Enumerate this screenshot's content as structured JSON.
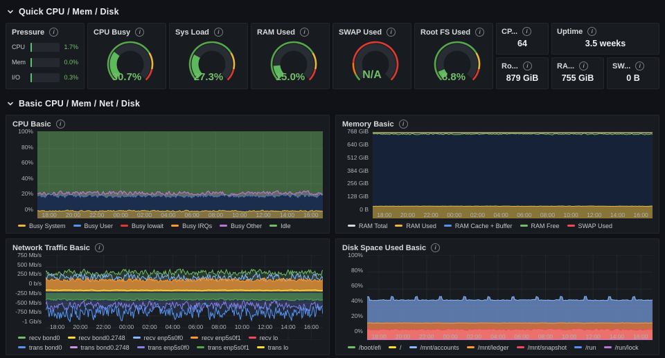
{
  "sections": {
    "quick": {
      "title": "Quick CPU / Mem / Disk"
    },
    "basic": {
      "title": "Basic CPU / Mem / Net / Disk"
    }
  },
  "pressure": {
    "title": "Pressure",
    "rows": [
      {
        "label": "CPU",
        "value": "1.7%",
        "frac": 0.017
      },
      {
        "label": "Mem",
        "value": "0.0%",
        "frac": 0.0
      },
      {
        "label": "I/O",
        "value": "0.3%",
        "frac": 0.003
      }
    ]
  },
  "gauge_segments": {
    "normal": [
      {
        "f0": 0,
        "f1": 0.72,
        "color": "#56A64B"
      },
      {
        "f0": 0.72,
        "f1": 0.88,
        "color": "#EAB839"
      },
      {
        "f0": 0.88,
        "f1": 1,
        "color": "#E0392F"
      }
    ],
    "swap": [
      {
        "f0": 0,
        "f1": 0.07,
        "color": "#56A64B"
      },
      {
        "f0": 0.07,
        "f1": 0.18,
        "color": "#FF780A"
      },
      {
        "f0": 0.18,
        "f1": 1,
        "color": "#E0392F"
      }
    ]
  },
  "gauges": [
    {
      "title": "CPU Busy",
      "value": 30.7,
      "display": "30.7%",
      "segments": "normal"
    },
    {
      "title": "Sys Load",
      "value": 27.3,
      "display": "27.3%",
      "segments": "normal"
    },
    {
      "title": "RAM Used",
      "value": 15.0,
      "display": "15.0%",
      "segments": "normal"
    },
    {
      "title": "SWAP Used",
      "value": null,
      "display": "N/A",
      "segments": "swap"
    },
    {
      "title": "Root FS Used",
      "value": 8.8,
      "display": "8.8%",
      "segments": "normal"
    }
  ],
  "stats": [
    {
      "title": "CP...",
      "value": "64"
    },
    {
      "title": "Uptime",
      "value": "3.5 weeks"
    },
    {
      "title": "Ro...",
      "value": "879 GiB"
    },
    {
      "title": "RA...",
      "value": "755 GiB"
    },
    {
      "title": "SW...",
      "value": "0 B"
    }
  ],
  "chart_data": [
    {
      "id": "cpu-basic",
      "title": "CPU Basic",
      "type": "area",
      "ymin": 0,
      "ymax": 100,
      "axis_w": 36,
      "grid": true,
      "y_ticks": [
        {
          "v": 0,
          "label": "0%"
        },
        {
          "v": 20,
          "label": "20%"
        },
        {
          "v": 40,
          "label": "40%"
        },
        {
          "v": 60,
          "label": "60%"
        },
        {
          "v": 80,
          "label": "80%"
        },
        {
          "v": 100,
          "label": "100%"
        }
      ],
      "x_ticks": [
        "18:00",
        "20:00",
        "22:00",
        "00:00",
        "02:00",
        "04:00",
        "06:00",
        "08:00",
        "10:00",
        "12:00",
        "14:00",
        "16:00"
      ],
      "legend": [
        {
          "name": "Busy System",
          "color": "#EAB839"
        },
        {
          "name": "Busy User",
          "color": "#5794F2"
        },
        {
          "name": "Busy Iowait",
          "color": "#E0392F"
        },
        {
          "name": "Busy IRQs",
          "color": "#FF9830"
        },
        {
          "name": "Busy Other",
          "color": "#B877D9"
        },
        {
          "name": "Idle",
          "color": "#73BF69"
        }
      ],
      "series": [
        {
          "name": "Idle",
          "mode": "area",
          "base": 100,
          "amp": 0,
          "stroke": "none",
          "fill": "rgba(115,191,105,0.45)",
          "seed": 1,
          "n": 4
        },
        {
          "name": "Busy Other",
          "mode": "area",
          "base": 29,
          "amp": 3.4,
          "stroke": "#C77BD9",
          "width": 1,
          "fill": "rgba(184,119,217,0.28)",
          "seed": 2,
          "n": 300
        },
        {
          "name": "Busy User",
          "mode": "area",
          "base": 25.5,
          "amp": 3,
          "stroke": "rgba(87,148,242,0.5)",
          "width": 1,
          "fill": "#1C2E4D",
          "seed": 3,
          "n": 300
        },
        {
          "name": "Busy System",
          "mode": "area",
          "base": 8.5,
          "amp": 1.3,
          "stroke": "#EAB839",
          "width": 1,
          "fill": "rgba(234,184,57,0.5)",
          "seed": 4,
          "n": 300
        }
      ]
    },
    {
      "id": "memory-basic",
      "title": "Memory Basic",
      "type": "area",
      "ymin": 0,
      "ymax": 768,
      "axis_w": 44,
      "grid": true,
      "y_ticks": [
        {
          "v": 0,
          "label": "0 B"
        },
        {
          "v": 128,
          "label": "128 GiB"
        },
        {
          "v": 256,
          "label": "256 GiB"
        },
        {
          "v": 384,
          "label": "384 GiB"
        },
        {
          "v": 512,
          "label": "512 GiB"
        },
        {
          "v": 640,
          "label": "640 GiB"
        },
        {
          "v": 768,
          "label": "768 GiB"
        }
      ],
      "x_ticks": [
        "18:00",
        "20:00",
        "22:00",
        "00:00",
        "02:00",
        "04:00",
        "06:00",
        "08:00",
        "10:00",
        "12:00",
        "14:00",
        "16:00"
      ],
      "legend": [
        {
          "name": "RAM Total",
          "color": "#D8D9DA"
        },
        {
          "name": "RAM Used",
          "color": "#EAB839"
        },
        {
          "name": "RAM Cache + Buffer",
          "color": "#5794F2"
        },
        {
          "name": "RAM Free",
          "color": "#73BF69"
        },
        {
          "name": "SWAP Used",
          "color": "#F2495C"
        }
      ],
      "series": [
        {
          "name": "RAM Cache + Buffer",
          "mode": "area",
          "base": 747,
          "amp": 1.5,
          "stroke": "none",
          "fill": "#152238",
          "seed": 5,
          "n": 200
        },
        {
          "name": "RAM Free",
          "mode": "line",
          "base": 744,
          "amp": 9,
          "stroke": "#73BF69",
          "width": 1,
          "seed": 6,
          "n": 300
        },
        {
          "name": "RAM Used",
          "mode": "area",
          "base": 108,
          "amp": 2.5,
          "stroke": "#EAB839",
          "width": 1,
          "fill": "rgba(234,184,57,0.55)",
          "seed": 7,
          "n": 300
        },
        {
          "name": "RAM Total",
          "mode": "line",
          "base": 755,
          "amp": 0,
          "stroke": "#A89968",
          "width": 2,
          "seed": 8,
          "n": 4
        }
      ]
    },
    {
      "id": "network-traffic-basic",
      "title": "Network Traffic Basic",
      "type": "line",
      "ymin": -1000,
      "ymax": 750,
      "axis_w": 48,
      "grid": true,
      "y_ticks": [
        {
          "v": -1000,
          "label": "-1 Gb/s"
        },
        {
          "v": -750,
          "label": "-750 Mb/s"
        },
        {
          "v": -500,
          "label": "-500 Mb/s"
        },
        {
          "v": -250,
          "label": "-250 Mb/s"
        },
        {
          "v": 0,
          "label": "0 b/s"
        },
        {
          "v": 250,
          "label": "250 Mb/s"
        },
        {
          "v": 500,
          "label": "500 Mb/s"
        },
        {
          "v": 750,
          "label": "750 Mb/s"
        }
      ],
      "x_ticks": [
        "18:00",
        "20:00",
        "22:00",
        "00:00",
        "02:00",
        "04:00",
        "06:00",
        "08:00",
        "10:00",
        "12:00",
        "14:00",
        "16:00"
      ],
      "legend": [
        {
          "name": "recv bond0",
          "color": "#73BF69"
        },
        {
          "name": "recv bond0.2748",
          "color": "#FADE2A"
        },
        {
          "name": "recv enp5s0f0",
          "color": "#8AB8FF"
        },
        {
          "name": "recv enp5s0f1",
          "color": "#FF9830"
        },
        {
          "name": "recv lo",
          "color": "#F2495C"
        },
        {
          "name": "trans bond0",
          "color": "#5794F2"
        },
        {
          "name": "trans bond0.2748",
          "color": "#CA95E5"
        },
        {
          "name": "trans enp5s0f0",
          "color": "#8F7EE8"
        },
        {
          "name": "trans enp5s0f1",
          "color": "#56A64B"
        },
        {
          "name": "trans lo",
          "color": "#FADE2A"
        }
      ],
      "series": [
        {
          "name": "recv bond0",
          "mode": "line",
          "base": 390,
          "amp": 95,
          "stroke": "#73BF69",
          "width": 1,
          "fill": "rgba(115,191,105,0.18)",
          "seed": 9,
          "n": 320
        },
        {
          "name": "recv enp5s0f0",
          "mode": "line",
          "base": 290,
          "amp": 115,
          "stroke": "#8AB8FF",
          "width": 1,
          "fill": "rgba(138,184,255,0.12)",
          "seed": 10,
          "n": 320
        },
        {
          "name": "recv enp5s0f1",
          "mode": "area",
          "base": 235,
          "amp": 55,
          "stroke": "#FF9830",
          "width": 1,
          "fill": "rgba(255,152,48,0.7)",
          "seed": 11,
          "n": 320
        },
        {
          "name": "trans lo",
          "mode": "line",
          "base": 24,
          "amp": 12,
          "stroke": "#FADE2A",
          "width": 1.5,
          "seed": 12,
          "n": 220
        },
        {
          "name": "trans enp5s0f0",
          "mode": "line",
          "base": -300,
          "amp": 150,
          "stroke": "#8F7EE8",
          "width": 1,
          "fill": "rgba(143,126,232,0.1)",
          "seed": 13,
          "n": 320
        },
        {
          "name": "trans bond0",
          "mode": "line",
          "base": -430,
          "amp": 235,
          "stroke": "#5794F2",
          "width": 1,
          "fill": "rgba(87,148,242,0.15)",
          "seed": 14,
          "n": 320
        },
        {
          "name": "trans enp5s0f1",
          "mode": "area",
          "base": -168,
          "amp": 30,
          "closeTo": -28,
          "stroke": "#56A64B",
          "width": 1,
          "fill": "rgba(86,166,75,0.55)",
          "seed": 15,
          "n": 320
        }
      ]
    },
    {
      "id": "disk-space-used-basic",
      "title": "Disk Space Used Basic",
      "type": "area",
      "ymin": 0,
      "ymax": 100,
      "axis_w": 36,
      "grid": true,
      "y_ticks": [
        {
          "v": 0,
          "label": "0%"
        },
        {
          "v": 20,
          "label": "20%"
        },
        {
          "v": 40,
          "label": "40%"
        },
        {
          "v": 60,
          "label": "60%"
        },
        {
          "v": 80,
          "label": "80%"
        },
        {
          "v": 100,
          "label": "100%"
        }
      ],
      "x_ticks": [
        "18:00",
        "20:00",
        "22:00",
        "00:00",
        "02:00",
        "04:00",
        "06:00",
        "08:00",
        "10:00",
        "12:00",
        "14:00",
        "16:00"
      ],
      "legend": [
        {
          "name": "/boot/efi",
          "color": "#73BF69"
        },
        {
          "name": "/",
          "color": "#FADE2A"
        },
        {
          "name": "/mnt/accounts",
          "color": "#8AB8FF"
        },
        {
          "name": "/mnt/ledger",
          "color": "#FF9830"
        },
        {
          "name": "/mnt/snapshot",
          "color": "#F2495C"
        },
        {
          "name": "/run",
          "color": "#5794F2"
        },
        {
          "name": "/run/lock",
          "color": "#B877D9"
        }
      ],
      "series": [
        {
          "name": "/mnt/accounts",
          "mode": "area",
          "base": 47,
          "amp": 0.8,
          "spike": {
            "every": 27,
            "width": 3,
            "h": 4
          },
          "stroke": "#8AB8FF",
          "width": 1,
          "fill": "rgba(109,143,201,0.8)",
          "seed": 16,
          "n": 320
        },
        {
          "name": "/mnt/ledger",
          "mode": "area",
          "base": 20,
          "amp": 0.5,
          "stroke": "#FF9830",
          "width": 1,
          "fill": "rgba(201,108,58,0.92)",
          "seed": 17,
          "n": 320
        },
        {
          "name": "/mnt/snapshot",
          "mode": "area",
          "base": 12.5,
          "amp": 1.4,
          "stroke": "#F2495C",
          "width": 1,
          "fill": "rgba(242,115,115,0.85)",
          "seed": 18,
          "n": 320
        },
        {
          "name": "/run/lock",
          "mode": "line",
          "base": 1.1,
          "amp": 0.2,
          "stroke": "#B877D9",
          "width": 1,
          "seed": 19,
          "n": 120
        }
      ]
    }
  ]
}
